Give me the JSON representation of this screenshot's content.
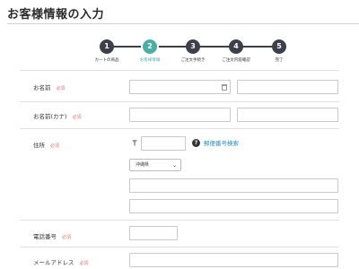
{
  "page": {
    "title": "お客様情報の入力"
  },
  "stepper": {
    "steps": [
      {
        "number": "1",
        "label": "カートの商品",
        "active": false
      },
      {
        "number": "2",
        "label": "お客様情報",
        "active": true
      },
      {
        "number": "3",
        "label": "ご注文手続き",
        "active": false
      },
      {
        "number": "4",
        "label": "ご注文内容確認",
        "active": false
      },
      {
        "number": "5",
        "label": "完了",
        "active": false
      }
    ]
  },
  "form": {
    "required_label": "必須",
    "name": {
      "label": "お名前",
      "last_value": "",
      "first_value": ""
    },
    "kana": {
      "label": "お名前(カナ)",
      "last_value": "",
      "first_value": ""
    },
    "address": {
      "label": "住所",
      "zip_value": "",
      "help": "?",
      "zip_search_link": "郵便番号検索",
      "prefecture_selected": "沖縄県",
      "line1_value": "",
      "line2_value": ""
    },
    "phone": {
      "label": "電話番号",
      "value": ""
    },
    "email": {
      "label": "メールアドレス",
      "value": ""
    }
  },
  "colors": {
    "accent": "#4aaea6",
    "step_dark": "#3d3f4b",
    "required": "#e57373",
    "link": "#2a8fb6"
  }
}
